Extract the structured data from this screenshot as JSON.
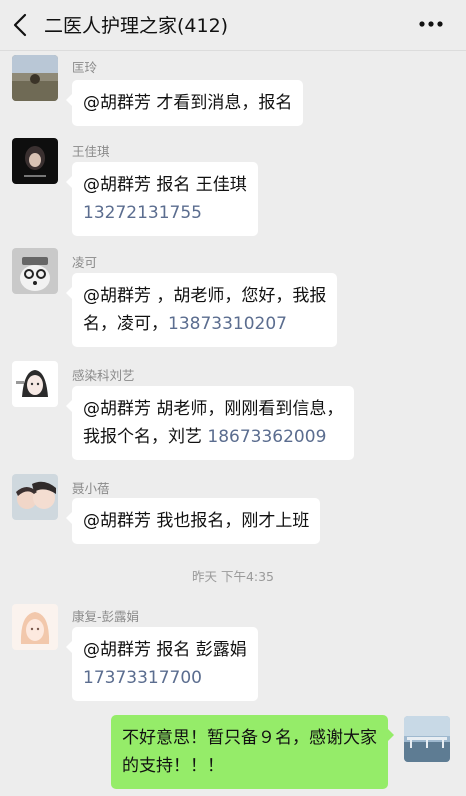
{
  "header": {
    "title": "二医人护理之家(412)"
  },
  "messages": [
    {
      "sender": "匡玲",
      "line1": "@胡群芳  才看到消息，报名"
    },
    {
      "sender": "王佳琪",
      "line1": "@胡群芳  报名 王佳琪",
      "phone": "13272131755"
    },
    {
      "sender": "凌可",
      "line1": "@胡群芳  ，胡老师，您好，我报",
      "line2": "名，凌可，",
      "phone": "13873310207"
    },
    {
      "sender": "感染科刘艺",
      "line1": "@胡群芳  胡老师，刚刚看到信息，",
      "line2": "我报个名，刘艺 ",
      "phone": "18673362009"
    },
    {
      "sender": "聂小蓓",
      "line1": "@胡群芳  我也报名，刚才上班"
    },
    {
      "sender": "康复-彭露娟",
      "line1": "@胡群芳  报名 彭露娟",
      "phone": "17373317700"
    }
  ],
  "timestamp": "昨天 下午4:35",
  "my_message": {
    "line1": "不好意思！暂只备９名，感谢大家",
    "line2": "的支持！！！"
  }
}
